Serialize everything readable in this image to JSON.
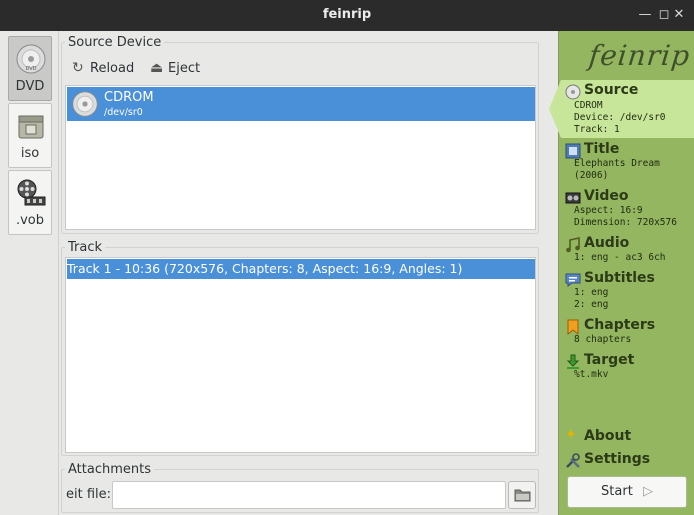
{
  "window": {
    "title": "feinrip"
  },
  "source_types": [
    {
      "label": "DVD",
      "icon": "dvd-disc-icon"
    },
    {
      "label": "iso",
      "icon": "iso-archive-icon"
    },
    {
      "label": ".vob",
      "icon": "film-reel-icon"
    }
  ],
  "source_device": {
    "group_label": "Source Device",
    "reload_label": "Reload",
    "eject_label": "Eject",
    "devices": [
      {
        "name": "CDROM",
        "path": "/dev/sr0"
      }
    ]
  },
  "track": {
    "group_label": "Track",
    "items": [
      "Track 1 - 10:36 (720x576, Chapters: 8, Aspect: 16:9, Angles: 1)"
    ]
  },
  "attachments": {
    "group_label": "Attachments",
    "eit_label": "eit file:",
    "eit_value": ""
  },
  "sidebar": {
    "logo": "feinrip",
    "steps": [
      {
        "title": "Source",
        "lines": [
          "CDROM",
          "Device: /dev/sr0",
          "Track: 1"
        ]
      },
      {
        "title": "Title",
        "lines": [
          "Elephants Dream",
          "(2006)"
        ]
      },
      {
        "title": "Video",
        "lines": [
          "Aspect: 16:9",
          "Dimension: 720x576"
        ]
      },
      {
        "title": "Audio",
        "lines": [
          "1: eng - ac3 6ch"
        ]
      },
      {
        "title": "Subtitles",
        "lines": [
          "1: eng",
          "2: eng"
        ]
      },
      {
        "title": "Chapters",
        "lines": [
          "8 chapters"
        ]
      },
      {
        "title": "Target",
        "lines": [
          "%t.mkv"
        ]
      }
    ],
    "about_label": "About",
    "settings_label": "Settings",
    "start_label": "Start"
  }
}
